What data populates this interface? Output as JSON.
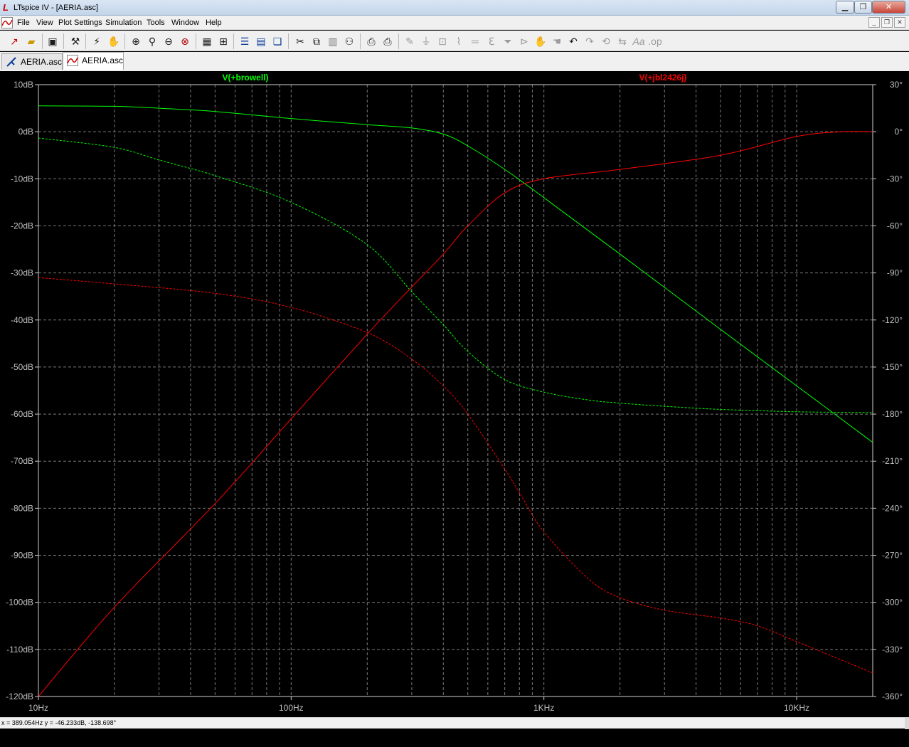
{
  "window": {
    "title": "LTspice IV - [AERIA.asc]"
  },
  "menu": {
    "items": [
      "File",
      "View",
      "Plot Settings",
      "Simulation",
      "Tools",
      "Window",
      "Help"
    ]
  },
  "toolbar": {
    "buttons": [
      "new-schematic",
      "open",
      "save",
      "control-panel",
      "run",
      "halt",
      "zoom-area",
      "zoom-in",
      "zoom-out",
      "zoom-fit",
      "autorange",
      "mark-data",
      "tile-horizontal",
      "tile-vertical",
      "cascade",
      "cut",
      "copy",
      "paste",
      "find",
      "print-setup",
      "print",
      "wire",
      "ground",
      "label",
      "resistor",
      "capacitor",
      "inductor",
      "diode",
      "component",
      "move",
      "drag",
      "undo",
      "redo",
      "rotate",
      "mirror",
      "text",
      "spice-directive"
    ]
  },
  "tabs": [
    {
      "label": "AERIA.asc",
      "icon": "schematic-icon",
      "active": false
    },
    {
      "label": "AERIA.asc",
      "icon": "waveform-icon",
      "active": true
    }
  ],
  "status": {
    "text": "x = 389.054Hz     y = -46.233dB, -138.698°"
  },
  "colors": {
    "green": "#00ff00",
    "red": "#ff0000",
    "grid": "#7a7a7a",
    "background": "#000000"
  },
  "chart_data": {
    "type": "line",
    "xscale": "log",
    "xlim": [
      10,
      20000
    ],
    "ylim": [
      -120,
      10
    ],
    "y2lim": [
      -360,
      30
    ],
    "grid": true,
    "x_ticks": [
      {
        "value": 10,
        "label": "10Hz"
      },
      {
        "value": 100,
        "label": "100Hz"
      },
      {
        "value": 1000,
        "label": "1KHz"
      },
      {
        "value": 10000,
        "label": "10KHz"
      }
    ],
    "y_ticks": [
      {
        "value": 10,
        "label": "10dB"
      },
      {
        "value": 0,
        "label": "0dB"
      },
      {
        "value": -10,
        "label": "-10dB"
      },
      {
        "value": -20,
        "label": "-20dB"
      },
      {
        "value": -30,
        "label": "-30dB"
      },
      {
        "value": -40,
        "label": "-40dB"
      },
      {
        "value": -50,
        "label": "-50dB"
      },
      {
        "value": -60,
        "label": "-60dB"
      },
      {
        "value": -70,
        "label": "-70dB"
      },
      {
        "value": -80,
        "label": "-80dB"
      },
      {
        "value": -90,
        "label": "-90dB"
      },
      {
        "value": -100,
        "label": "-100dB"
      },
      {
        "value": -110,
        "label": "-110dB"
      },
      {
        "value": -120,
        "label": "-120dB"
      }
    ],
    "y2_ticks": [
      {
        "value": 30,
        "label": "30°"
      },
      {
        "value": 0,
        "label": "0°"
      },
      {
        "value": -30,
        "label": "-30°"
      },
      {
        "value": -60,
        "label": "-60°"
      },
      {
        "value": -90,
        "label": "-90°"
      },
      {
        "value": -120,
        "label": "-120°"
      },
      {
        "value": -150,
        "label": "-150°"
      },
      {
        "value": -180,
        "label": "-180°"
      },
      {
        "value": -210,
        "label": "-210°"
      },
      {
        "value": -240,
        "label": "-240°"
      },
      {
        "value": -270,
        "label": "-270°"
      },
      {
        "value": -300,
        "label": "-300°"
      },
      {
        "value": -330,
        "label": "-330°"
      },
      {
        "value": -360,
        "label": "-360°"
      }
    ],
    "series": [
      {
        "name": "V(+browell)",
        "color": "#00ff00",
        "kind": "magnitude",
        "x": [
          10,
          20,
          30,
          50,
          100,
          200,
          300,
          400,
          500,
          700,
          1000,
          2000,
          5000,
          10000,
          20000
        ],
        "y": [
          5.5,
          5.4,
          5.0,
          4.3,
          2.8,
          1.5,
          0.8,
          -0.5,
          -3.0,
          -8.0,
          -14.0,
          -26.0,
          -42.0,
          -54.0,
          -66.0
        ]
      },
      {
        "name": "V(+browell) phase",
        "color": "#00ff00",
        "kind": "phase",
        "dashed": true,
        "x": [
          10,
          20,
          30,
          50,
          100,
          200,
          300,
          400,
          500,
          700,
          1000,
          1500,
          2000,
          3000,
          5000,
          10000,
          20000
        ],
        "y": [
          -4,
          -10,
          -18,
          -28,
          -45,
          -72,
          -102,
          -123,
          -140,
          -158,
          -166,
          -171,
          -173,
          -175,
          -177,
          -178.5,
          -179
        ]
      },
      {
        "name": "V(+jbl2426j)",
        "color": "#ff0000",
        "kind": "magnitude",
        "x": [
          10,
          20,
          50,
          100,
          200,
          300,
          400,
          500,
          700,
          1000,
          2000,
          5000,
          10000,
          15000,
          20000
        ],
        "y": [
          -120,
          -101,
          -79,
          -61,
          -43,
          -33,
          -26,
          -20,
          -13,
          -10,
          -8,
          -5,
          -1,
          0,
          0
        ]
      },
      {
        "name": "V(+jbl2426j) phase",
        "color": "#ff0000",
        "kind": "phase",
        "dashed": true,
        "x": [
          10,
          20,
          50,
          100,
          200,
          300,
          400,
          500,
          700,
          800,
          1000,
          1500,
          2000,
          3000,
          5000,
          7000,
          10000,
          20000
        ],
        "y": [
          -93,
          -97,
          -103,
          -112,
          -128,
          -145,
          -162,
          -180,
          -215,
          -230,
          -255,
          -285,
          -297,
          -305,
          -310,
          -315,
          -325,
          -345
        ]
      }
    ],
    "legend": [
      "V(+browell)",
      "V(+jbl2426j)"
    ]
  }
}
